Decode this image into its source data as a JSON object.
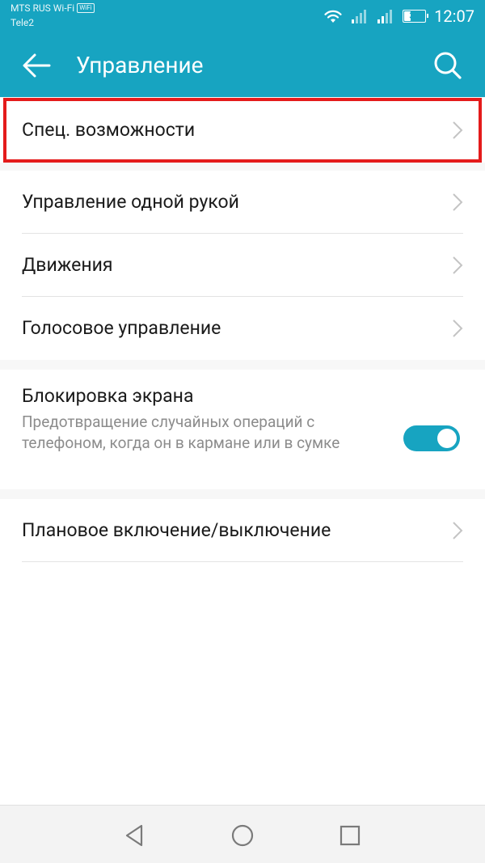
{
  "status_bar": {
    "carrier_1": "MTS RUS Wi-Fi",
    "carrier_1_badge": "WiFi",
    "carrier_2": "Tele2",
    "battery_level": "37",
    "battery_fraction": 0.37,
    "time": "12:07",
    "icons": [
      "wifi-icon",
      "signal-icon",
      "signal-icon",
      "battery-icon"
    ]
  },
  "app_bar": {
    "title": "Управление",
    "back_icon": "arrow-left-icon",
    "search_icon": "search-icon"
  },
  "sections": {
    "accessibility": {
      "label": "Спец. возможности",
      "highlighted": true,
      "highlight_color": "#e41b1b"
    },
    "main_items": [
      {
        "label": "Управление одной рукой"
      },
      {
        "label": "Движения"
      },
      {
        "label": "Голосовое управление"
      }
    ],
    "screen_lock": {
      "title": "Блокировка экрана",
      "summary": "Предотвращение случайных операций с телефоном, когда он в кармане или в сумке",
      "enabled": true
    },
    "schedule": {
      "label": "Плановое включение/выключение"
    }
  },
  "nav_bar": {
    "icons": [
      "nav-back-icon",
      "nav-home-icon",
      "nav-recent-icon"
    ]
  },
  "colors": {
    "accent": "#17a4c1",
    "background": "#f7f7f7",
    "card": "#ffffff",
    "secondary_text": "#8c8c8c"
  }
}
